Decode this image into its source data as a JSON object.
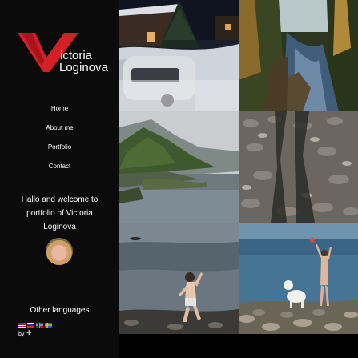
{
  "logo": {
    "line1": "ictoria",
    "line2": "Loginova",
    "accent_color": "#d31f26"
  },
  "nav": {
    "items": [
      "Home",
      "About me",
      "Portfolio",
      "Contact"
    ]
  },
  "welcome": {
    "text": "Hallo and welcome to portfolio of Victoria Loginova"
  },
  "languages": {
    "heading": "Other languages",
    "flags": [
      "usa-flag",
      "russia-flag",
      "norway-flag",
      "sweden-flag"
    ]
  },
  "credit": {
    "by": "by"
  },
  "gallery": {
    "photos": [
      "snowy-cabin-night",
      "forest-river",
      "fjord-mountains",
      "shadows-on-stones",
      "child-on-beach",
      "girl-with-dog-by-sea"
    ]
  }
}
